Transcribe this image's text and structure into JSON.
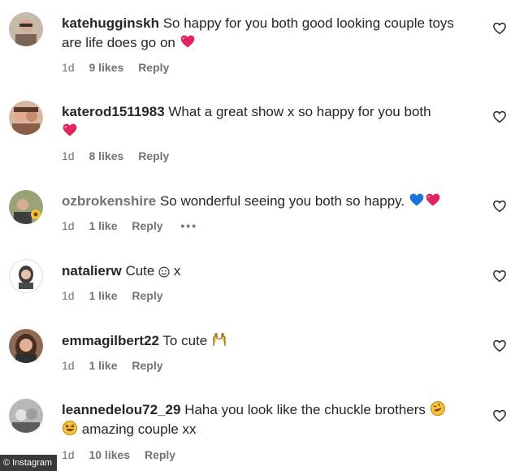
{
  "comments": [
    {
      "username": "katehugginskh",
      "text": "So happy for you both good looking couple toys are life does go on",
      "time": "1d",
      "likes": "9 likes",
      "reply": "Reply"
    },
    {
      "username": "katerod1511983",
      "text": "What a great show x so happy for you both",
      "time": "1d",
      "likes": "8 likes",
      "reply": "Reply"
    },
    {
      "username": "ozbrokenshire",
      "text": "So wonderful seeing you both so happy.",
      "time": "1d",
      "likes": "1 like",
      "reply": "Reply",
      "more": "•••"
    },
    {
      "username": "natalierw",
      "text": "Cute",
      "text_after": "x",
      "time": "1d",
      "likes": "1 like",
      "reply": "Reply"
    },
    {
      "username": "emmagilbert22",
      "text": "To cute",
      "time": "1d",
      "likes": "1 like",
      "reply": "Reply"
    },
    {
      "username": "leannedelou72_29",
      "text": "Haha you look like the chuckle brothers",
      "text_line2": "amazing couple xx",
      "time": "1d",
      "likes": "10 likes",
      "reply": "Reply"
    }
  ],
  "watermark": "© Instagram",
  "icons": {
    "like": "heart-outline-icon",
    "red_heart": "red-heart-emoji",
    "blue_heart": "blue-heart-emoji",
    "more": "more-options-icon"
  },
  "colors": {
    "username": "#262626",
    "meta": "#737373",
    "red_heart": "#e0245e",
    "blue_heart": "#1d74d8"
  }
}
